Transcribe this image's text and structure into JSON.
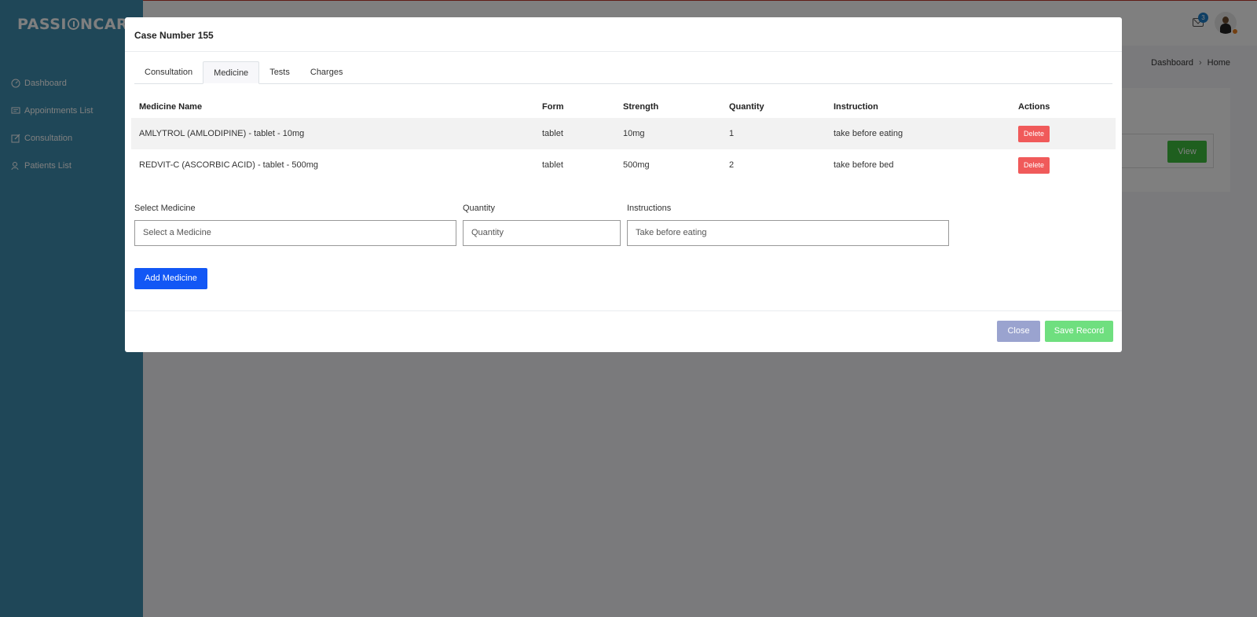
{
  "app": {
    "logo_text_1": "PASSI",
    "logo_text_2": "NCARE"
  },
  "sidebar": {
    "items": [
      {
        "label": "Dashboard",
        "icon": "dashboard-icon"
      },
      {
        "label": "Appointments List",
        "icon": "chat-icon"
      },
      {
        "label": "Consultation",
        "icon": "edit-icon"
      },
      {
        "label": "Patients List",
        "icon": "users-icon"
      }
    ]
  },
  "header": {
    "notifications_count": "3"
  },
  "breadcrumb": {
    "items": [
      "Dashboard",
      "Home"
    ]
  },
  "background": {
    "view_label": "View"
  },
  "modal": {
    "title": "Case Number 155",
    "tabs": [
      "Consultation",
      "Medicine",
      "Tests",
      "Charges"
    ],
    "active_tab": "Medicine",
    "table": {
      "headers": [
        "Medicine Name",
        "Form",
        "Strength",
        "Quantity",
        "Instruction",
        "Actions"
      ],
      "rows": [
        {
          "name": "AMLYTROL (AMLODIPINE) - tablet - 10mg",
          "form": "tablet",
          "strength": "10mg",
          "quantity": "1",
          "instruction": "take before eating",
          "action": "Delete"
        },
        {
          "name": "REDVIT-C (ASCORBIC ACID) - tablet - 500mg",
          "form": "tablet",
          "strength": "500mg",
          "quantity": "2",
          "instruction": "take before bed",
          "action": "Delete"
        }
      ]
    },
    "form": {
      "medicine_label": "Select Medicine",
      "medicine_placeholder": "Select a Medicine",
      "quantity_label": "Quantity",
      "quantity_placeholder": "Quantity",
      "instructions_label": "Instructions",
      "instructions_placeholder": "Take before eating",
      "add_button": "Add Medicine"
    },
    "footer": {
      "close_label": "Close",
      "save_label": "Save Record"
    }
  },
  "colors": {
    "sidebar": "#3e8fb0",
    "primary": "#1257f5",
    "danger": "#f05a5a",
    "success": "#6fdf7f",
    "secondary": "#9aa3cf"
  }
}
